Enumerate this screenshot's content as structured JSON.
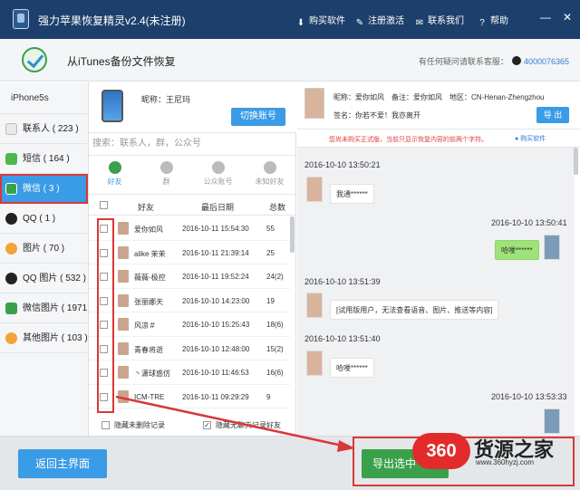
{
  "window": {
    "title": "强力苹果恢复精灵v2.4(未注册)",
    "toolbar": [
      {
        "label": "购买软件",
        "icon": "buy-icon"
      },
      {
        "label": "注册激活",
        "icon": "register-icon"
      },
      {
        "label": "联系我们",
        "icon": "contact-icon"
      },
      {
        "label": "帮助",
        "icon": "help-icon"
      }
    ],
    "controls": {
      "minimize": "—",
      "close": "✕"
    }
  },
  "header": {
    "title": "从iTunes备份文件恢复",
    "support_label": "有任何疑问请联系客服：",
    "support_qq": "4000076365"
  },
  "sidebar": {
    "device": "iPhone5s",
    "items": [
      {
        "label": "联系人 ( 223 )",
        "icon": "contacts-icon",
        "color": "#e9e9e9"
      },
      {
        "label": "短信 ( 164 )",
        "icon": "sms-icon",
        "color": "#4cb84c"
      },
      {
        "label": "微信 ( 3 )",
        "icon": "wechat-icon",
        "color": "#3aa04a"
      },
      {
        "label": "QQ ( 1 )",
        "icon": "qq-icon",
        "color": "#222222"
      },
      {
        "label": "图片 ( 70 )",
        "icon": "photos-icon",
        "color": "#f2a33a"
      },
      {
        "label": "QQ 图片 ( 532 )",
        "icon": "qq-photos-icon",
        "color": "#222222"
      },
      {
        "label": "微信图片 ( 1971 )",
        "icon": "wechat-photos-icon",
        "color": "#3aa04a"
      },
      {
        "label": "其他图片 ( 103 )",
        "icon": "other-photos-icon",
        "color": "#f2a33a"
      }
    ]
  },
  "account": {
    "nickname_label": "昵称：王尼玛",
    "switch_label": "切换账号"
  },
  "search": {
    "placeholder": "搜索：联系人，群，公众号"
  },
  "tabs": [
    {
      "label": "好友",
      "icon": "friend-icon"
    },
    {
      "label": "群",
      "icon": "group-icon"
    },
    {
      "label": "公众账号",
      "icon": "official-account-icon"
    },
    {
      "label": "未知好友",
      "icon": "unknown-friend-icon"
    }
  ],
  "table": {
    "headers": {
      "name": "好友",
      "date": "最后日期",
      "total": "总数"
    },
    "rows": [
      {
        "name": "爱你如风",
        "date": "2016-10-11 15:54:30",
        "total": "55"
      },
      {
        "name": "alike 茉茉",
        "date": "2016-10-11 21:39:14",
        "total": "25"
      },
      {
        "name": "薇薇-极控",
        "date": "2016-10-11 19:52:24",
        "total": "24(2)"
      },
      {
        "name": "张丽娜天",
        "date": "2016-10-10 14:23:00",
        "total": "19"
      },
      {
        "name": "风凉＃",
        "date": "2016-10-10 15:25:43",
        "total": "18(6)"
      },
      {
        "name": "青春将逝",
        "date": "2016-10-10 12:48:00",
        "total": "15(2)"
      },
      {
        "name": "丶潇球惑仿",
        "date": "2016-10-10 11:46:53",
        "total": "16(6)"
      },
      {
        "name": "ICM-TRE",
        "date": "2016-10-11 09:29:29",
        "total": "9"
      }
    ]
  },
  "options": {
    "hide_deleted": "隐藏未删除记录",
    "hide_empty": "隐藏无聊天记录好友"
  },
  "chat": {
    "contact_info": "昵称：爱你如风　备注：爱你如风　地区：CN-Henan-Zhengzhou",
    "signature": "签名：你若不爱！我亦离开",
    "export_label": "导 出",
    "notice": "您尚未购买正式版，当前只显示恢复内容的前两个字符。",
    "buy_link": "购买软件",
    "messages": [
      {
        "time": "2016-10-10 13:50:21",
        "text": "我通******",
        "side": "left"
      },
      {
        "time": "2016-10-10 13:50:41",
        "text": "哈喽******",
        "side": "right"
      },
      {
        "time": "2016-10-10 13:51:39",
        "text": "[试用版用户，无法查看语音、图片、推送等内容]",
        "side": "left"
      },
      {
        "time": "2016-10-10 13:51:40",
        "text": "哈喽******",
        "side": "left"
      },
      {
        "time": "2016-10-10 13:53:33",
        "text": "",
        "side": "right"
      }
    ]
  },
  "footer": {
    "back_label": "返回主界面",
    "export_selected_label": "导出选中"
  },
  "watermark": {
    "circle": "360",
    "title": "货源之家",
    "url": "www.360hyzj.com"
  },
  "colors": {
    "accent": "#3a9be6",
    "highlight": "#d9383a",
    "title_bar": "#1d3f6b",
    "bubble_me": "#9ee27a"
  }
}
